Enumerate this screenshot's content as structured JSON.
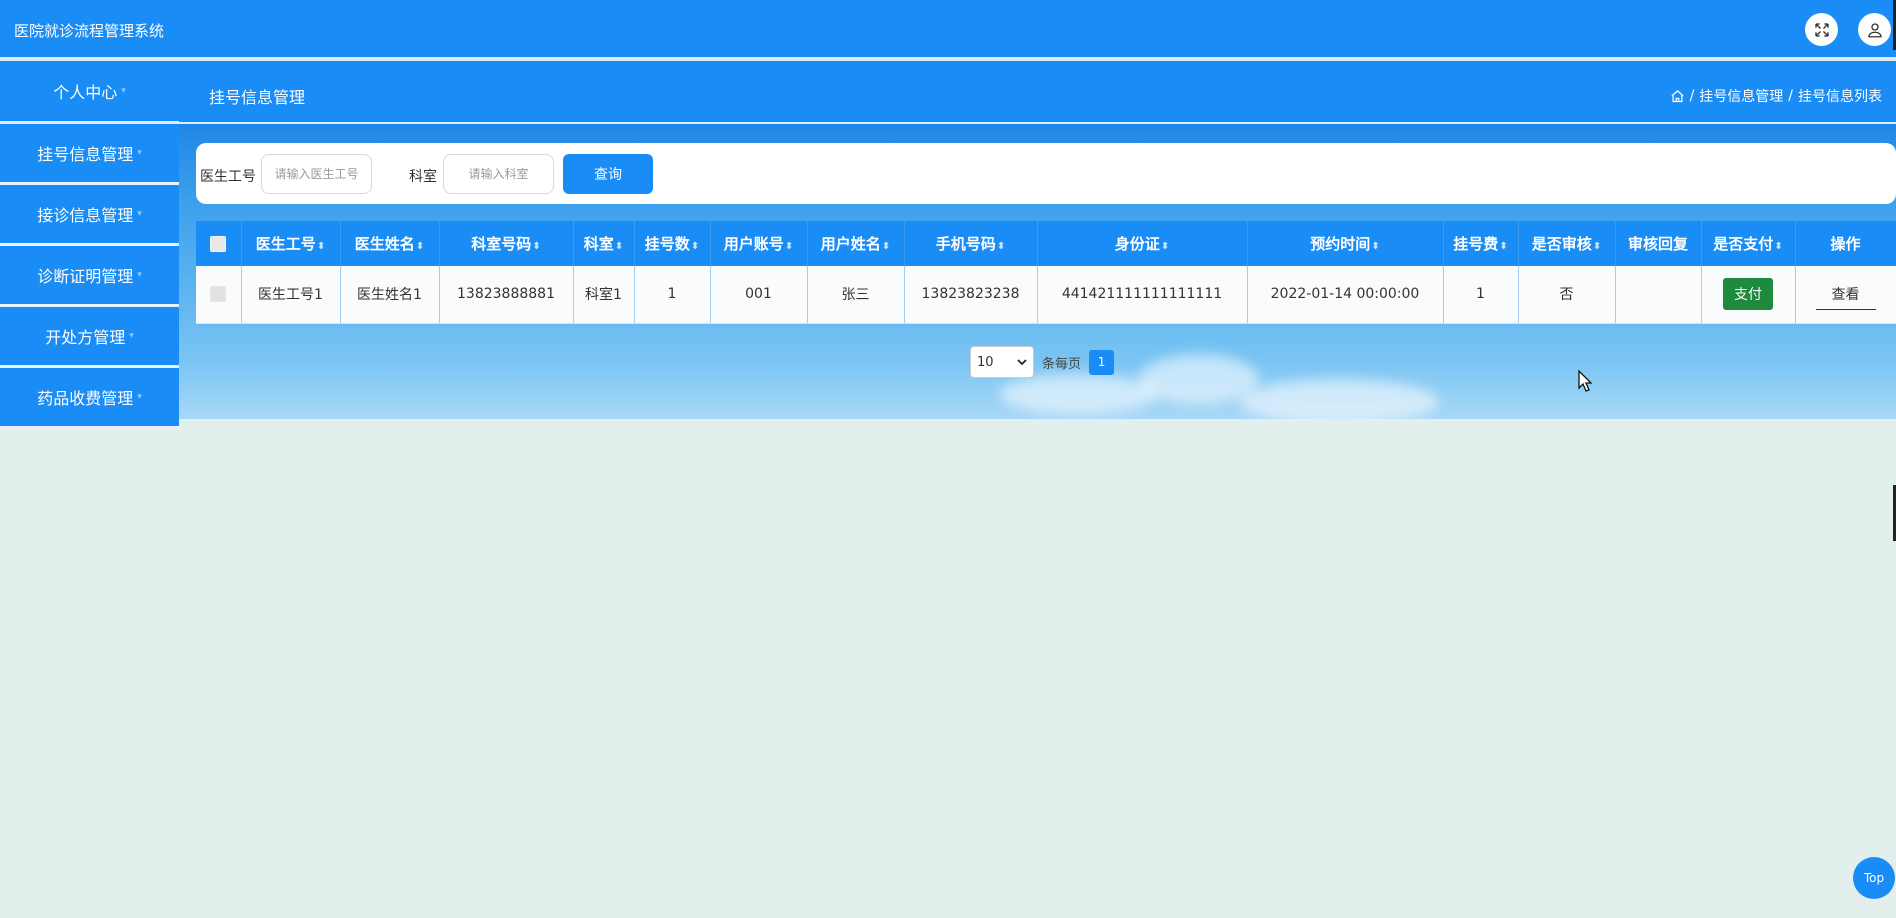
{
  "app": {
    "title": "医院就诊流程管理系统"
  },
  "header": {
    "fullscreen_icon": "expand-icon",
    "user_icon": "user-icon",
    "page_title": "挂号信息管理",
    "breadcrumb": {
      "home_icon": "home-icon",
      "sep": "/",
      "level1": "挂号信息管理",
      "level2": "挂号信息列表"
    }
  },
  "sidebar": {
    "caret": "▾",
    "items": [
      {
        "label": "个人中心"
      },
      {
        "label": "挂号信息管理"
      },
      {
        "label": "接诊信息管理"
      },
      {
        "label": "诊断证明管理"
      },
      {
        "label": "开处方管理"
      },
      {
        "label": "药品收费管理"
      }
    ]
  },
  "search": {
    "doctor_id_label": "医生工号",
    "doctor_id_placeholder": "请输入医生工号",
    "dept_label": "科室",
    "dept_placeholder": "请输入科室",
    "submit_label": "查询"
  },
  "table": {
    "sort_icon": "⬍",
    "headers": [
      "医生工号",
      "医生姓名",
      "科室号码",
      "科室",
      "挂号数",
      "用户账号",
      "用户姓名",
      "手机号码",
      "身份证",
      "预约时间",
      "挂号费",
      "是否审核",
      "审核回复",
      "是否支付",
      "操作"
    ],
    "rows": [
      {
        "doctor_id": "医生工号1",
        "doctor_name": "医生姓名1",
        "dept_phone": "13823888881",
        "dept": "科室1",
        "count": "1",
        "user_account": "001",
        "user_name": "张三",
        "phone": "13823823238",
        "id_card": "441421111111111111",
        "appointment_time": "2022-01-14 00:00:00",
        "fee": "1",
        "reviewed": "否",
        "review_reply": "",
        "pay_label": "支付",
        "view_label": "查看"
      }
    ]
  },
  "pagination": {
    "page_size": "10",
    "per_page_text": "条每页",
    "current_page": "1"
  },
  "float_top": {
    "label": "Top"
  },
  "colors": {
    "primary": "#1a8cf5",
    "pay_button": "#1d8a3e",
    "page_bg": "#e3efec"
  }
}
